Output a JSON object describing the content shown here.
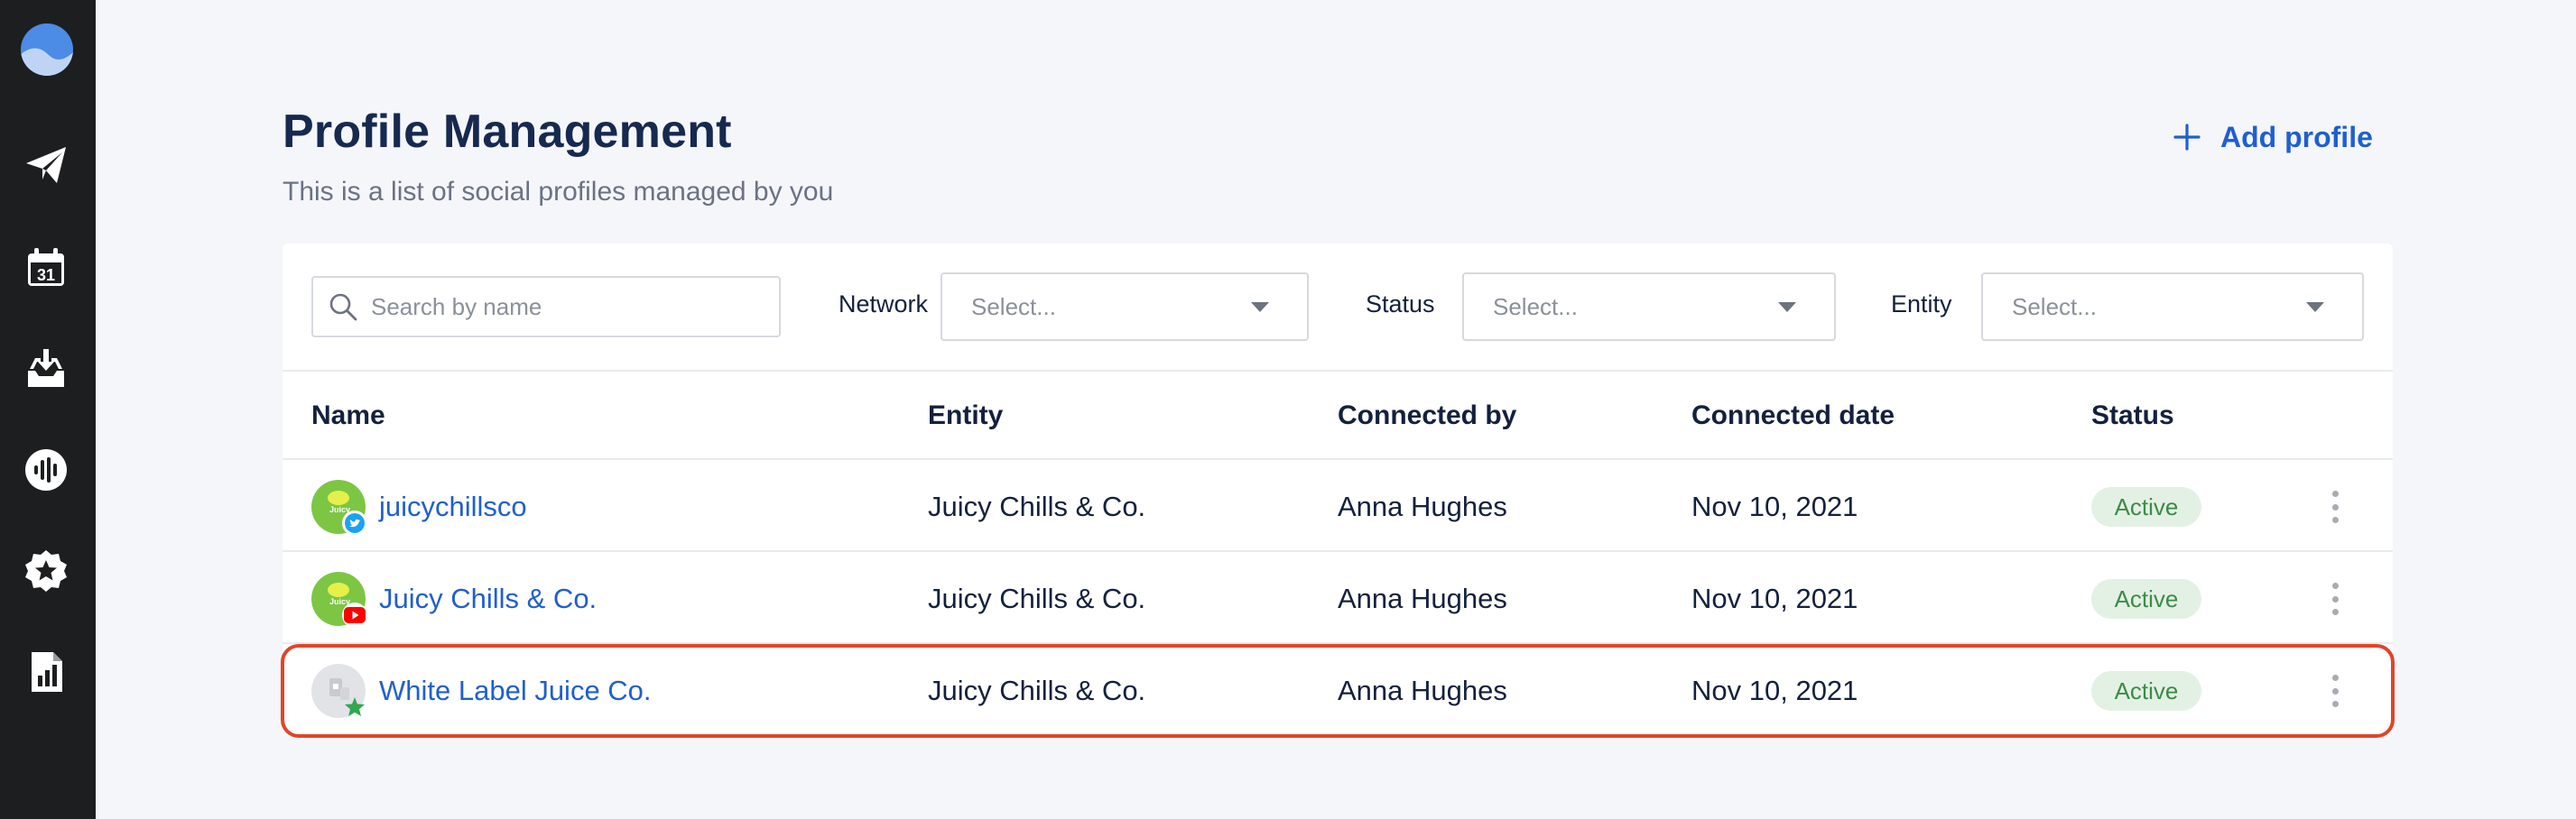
{
  "colors": {
    "sidebar": "#1d1e20",
    "accent": "#1f5fd0",
    "title": "#16294f",
    "active_bg": "#e3f1e4",
    "active_text": "#3d8b47",
    "highlight": "#e0452a"
  },
  "sidebar": {
    "items": [
      {
        "icon": "paper-plane-icon"
      },
      {
        "icon": "calendar-icon",
        "text": "31"
      },
      {
        "icon": "inbox-icon"
      },
      {
        "icon": "listening-icon"
      },
      {
        "icon": "star-badge-icon"
      },
      {
        "icon": "report-icon"
      }
    ]
  },
  "header": {
    "title": "Profile Management",
    "subtitle": "This is a list of social profiles managed by you",
    "add_label": "Add profile"
  },
  "filters": {
    "search_placeholder": "Search by name",
    "network_label": "Network",
    "network_value": "Select...",
    "status_label": "Status",
    "status_value": "Select...",
    "entity_label": "Entity",
    "entity_value": "Select..."
  },
  "table": {
    "columns": [
      "Name",
      "Entity",
      "Connected by",
      "Connected date",
      "Status"
    ],
    "rows": [
      {
        "name": "juicychillsco",
        "network": "twitter",
        "entity": "Juicy Chills & Co.",
        "connected_by": "Anna Hughes",
        "connected_date": "Nov 10, 2021",
        "status": "Active"
      },
      {
        "name": "Juicy Chills & Co.",
        "network": "youtube",
        "entity": "Juicy Chills & Co.",
        "connected_by": "Anna Hughes",
        "connected_date": "Nov 10, 2021",
        "status": "Active"
      },
      {
        "name": "White Label Juice Co.",
        "network": "review-star",
        "entity": "Juicy Chills & Co.",
        "connected_by": "Anna Hughes",
        "connected_date": "Nov 10, 2021",
        "status": "Active"
      }
    ]
  }
}
